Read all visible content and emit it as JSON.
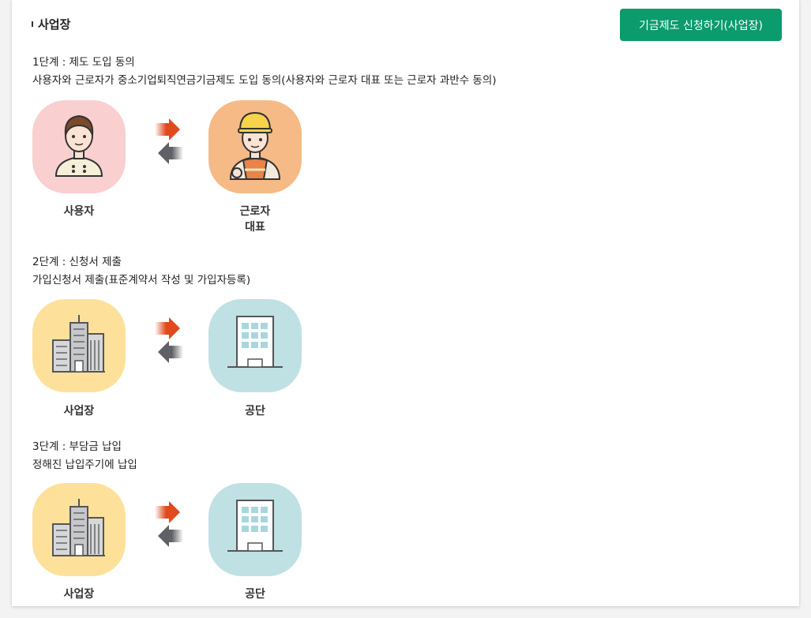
{
  "section": {
    "title": "사업장"
  },
  "apply_button": {
    "label": "기금제도 신청하기(사업장)"
  },
  "colors": {
    "accent": "#0b9b6c",
    "arrow_right": "#e04a1c",
    "arrow_left": "#5f6166",
    "pink": "#f9cfd0",
    "orange": "#f6ba86",
    "yellow": "#fde19a",
    "teal": "#bfe1e3"
  },
  "steps": [
    {
      "title": "1단계 : 제도 도입 동의",
      "desc": "사용자와 근로자가 중소기업퇴직연금기금제도 도입 동의(사용자와 근로자 대표 또는 근로자 과반수 동의)",
      "left": {
        "icon": "employer-person-icon",
        "label": "사용자"
      },
      "right": {
        "icon": "worker-helmet-icon",
        "label_line1": "근로자",
        "label_line2": "대표"
      }
    },
    {
      "title": "2단계 : 신청서 제출",
      "desc": "가입신청서 제출(표준계약서 작성 및 가입자등록)",
      "left": {
        "icon": "city-buildings-icon",
        "label": "사업장"
      },
      "right": {
        "icon": "office-building-icon",
        "label": "공단"
      }
    },
    {
      "title": "3단계 : 부담금 납입",
      "desc": "정해진 납입주기에 납입",
      "left": {
        "icon": "city-buildings-icon",
        "label": "사업장"
      },
      "right": {
        "icon": "office-building-icon",
        "label": "공단"
      }
    }
  ]
}
